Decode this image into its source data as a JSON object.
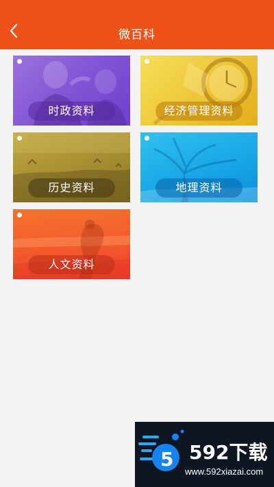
{
  "header": {
    "title": "微百科",
    "back_icon": "chevron-left-icon",
    "background_color": "#ee5219"
  },
  "cards": [
    {
      "label": "时政资料",
      "color": "#8357d6"
    },
    {
      "label": "经济管理资料",
      "color": "#edc73a"
    },
    {
      "label": "历史资料",
      "color": "#a98f32"
    },
    {
      "label": "地理资料",
      "color": "#19a7e6"
    },
    {
      "label": "人文资料",
      "color": "#f35a2c"
    }
  ],
  "watermark": {
    "brand": "592下载",
    "url": "www.592xiazai.com"
  }
}
